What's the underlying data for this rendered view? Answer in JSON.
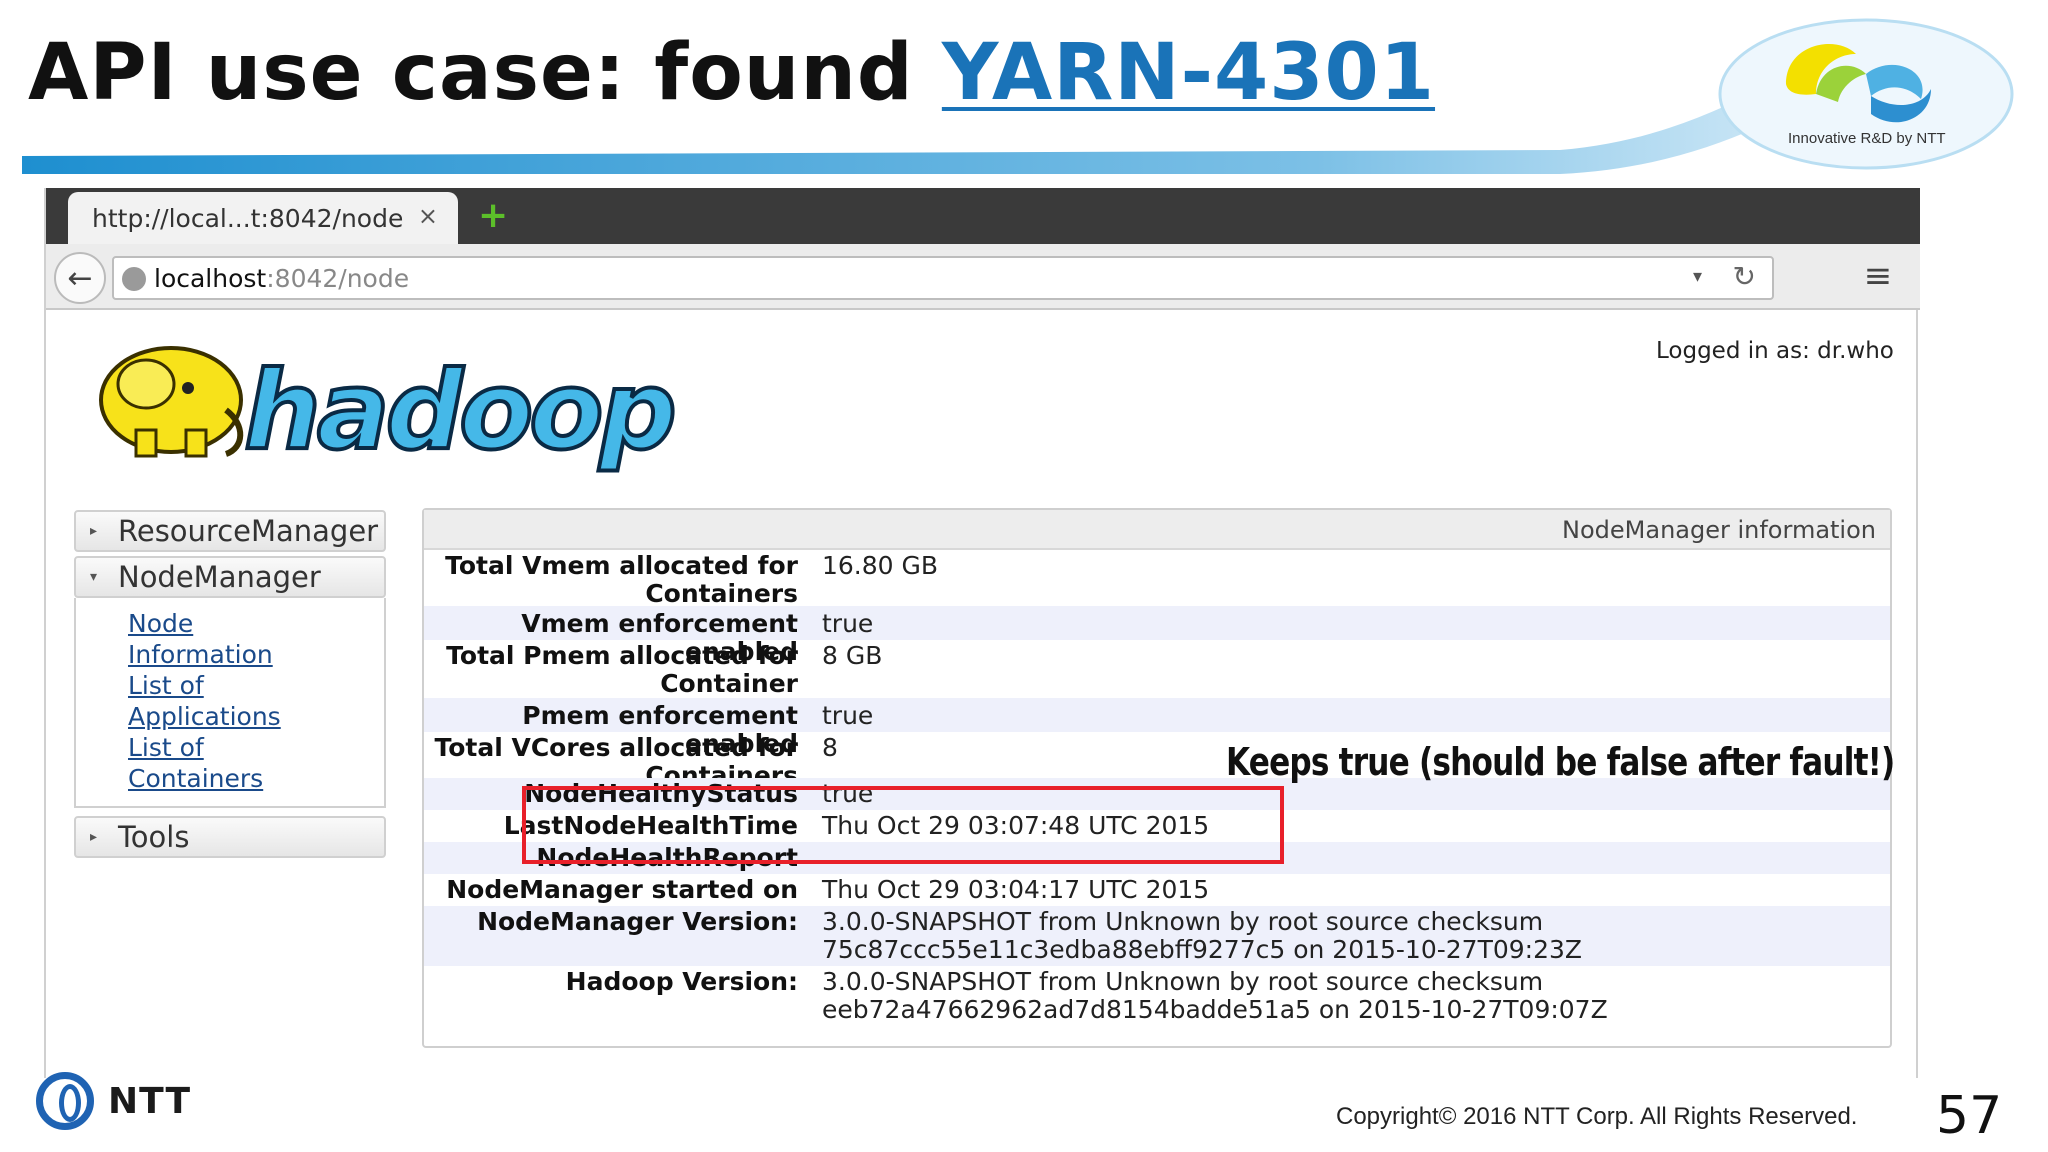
{
  "slide": {
    "title_prefix": "API use case: found ",
    "title_link": "YARN-4301",
    "logo_caption": "Innovative R&D by NTT",
    "footer_brand": "NTT",
    "copyright": "Copyright© 2016  NTT Corp. All Rights Reserved.",
    "page_number": "57"
  },
  "browser": {
    "tab_title": "http://local...t:8042/node",
    "tab_close": "×",
    "new_tab": "+",
    "url_host": "localhost",
    "url_rest": ":8042/node"
  },
  "page": {
    "logged_in": "Logged in as: dr.who",
    "sidebar": {
      "resource_manager": "ResourceManager",
      "node_manager": "NodeManager",
      "links": [
        "Node",
        "Information",
        "List of",
        "Applications",
        "List of",
        "Containers"
      ],
      "tools": "Tools"
    },
    "panel_title": "NodeManager information",
    "rows": [
      {
        "k1": "Total Vmem allocated for",
        "k2": "Containers",
        "v1": "16.80 GB",
        "v2": ""
      },
      {
        "k1": "Vmem enforcement enabled",
        "k2": "",
        "v1": "true",
        "v2": ""
      },
      {
        "k1": "Total Pmem allocated for",
        "k2": "Container",
        "v1": "8 GB",
        "v2": ""
      },
      {
        "k1": "Pmem enforcement enabled",
        "k2": "",
        "v1": "true",
        "v2": ""
      },
      {
        "k1": "Total VCores allocated for",
        "k2": "Containers",
        "v1": "8",
        "v2": ""
      },
      {
        "k1": "NodeHealthyStatus",
        "k2": "",
        "v1": "true",
        "v2": ""
      },
      {
        "k1": "LastNodeHealthTime",
        "k2": "",
        "v1": "Thu Oct 29 03:07:48 UTC 2015",
        "v2": ""
      },
      {
        "k1": "NodeHealthReport",
        "k2": "",
        "v1": "",
        "v2": ""
      },
      {
        "k1": "NodeManager started on",
        "k2": "",
        "v1": "Thu Oct 29 03:04:17 UTC 2015",
        "v2": ""
      },
      {
        "k1": "NodeManager Version:",
        "k2": "",
        "v1": "3.0.0-SNAPSHOT from Unknown by root source checksum",
        "v2": "75c87ccc55e11c3edba88ebff9277c5 on 2015-10-27T09:23Z"
      },
      {
        "k1": "Hadoop Version:",
        "k2": "",
        "v1": "3.0.0-SNAPSHOT from Unknown by root source checksum",
        "v2": "eeb72a47662962ad7d8154badde51a5 on 2015-10-27T09:07Z"
      }
    ],
    "callout": "Keeps true  (should be false after fault!)"
  },
  "colors": {
    "link_blue": "#1a73b8",
    "highlight_red": "#e8202a",
    "swoosh_blue": "#2a9ad6",
    "row_alt": "#eef0fb"
  }
}
